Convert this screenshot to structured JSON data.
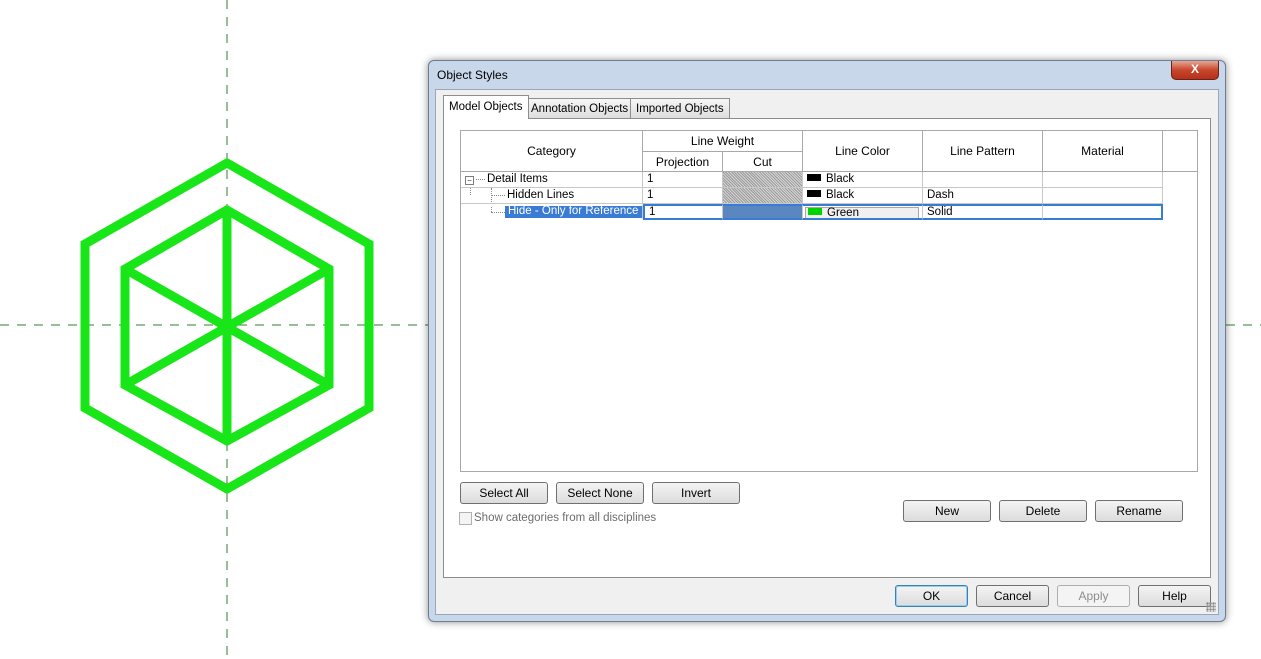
{
  "dialog": {
    "title": "Object Styles",
    "close_label": "X",
    "tabs": [
      {
        "label": "Model Objects",
        "active": true
      },
      {
        "label": "Annotation Objects",
        "active": false
      },
      {
        "label": "Imported Objects",
        "active": false
      }
    ]
  },
  "grid": {
    "headers": {
      "category": "Category",
      "line_weight": "Line Weight",
      "projection": "Projection",
      "cut": "Cut",
      "line_color": "Line Color",
      "line_pattern": "Line Pattern",
      "material": "Material"
    },
    "rows": [
      {
        "category": "Detail Items",
        "projection": "1",
        "color_name": "Black",
        "color_hex": "#000000",
        "pattern": "",
        "material": ""
      },
      {
        "category": "Hidden Lines",
        "projection": "1",
        "color_name": "Black",
        "color_hex": "#000000",
        "pattern": "Dash",
        "material": ""
      },
      {
        "category": "Hide - Only for Reference",
        "projection": "1",
        "color_name": "Green",
        "color_hex": "#00d400",
        "pattern": "Solid",
        "material": ""
      }
    ],
    "tree_expander": "−"
  },
  "buttons": {
    "select_all": "Select All",
    "select_none": "Select None",
    "invert": "Invert",
    "new": "New",
    "delete": "Delete",
    "rename": "Rename",
    "ok": "OK",
    "cancel": "Cancel",
    "apply": "Apply",
    "help": "Help"
  },
  "show_all_disciplines": {
    "label": "Show categories from all disciplines",
    "checked": false
  },
  "colors": {
    "shape_green": "#19e619",
    "reference_line": "#2f7d2f",
    "selection": "#3a7bd5"
  }
}
